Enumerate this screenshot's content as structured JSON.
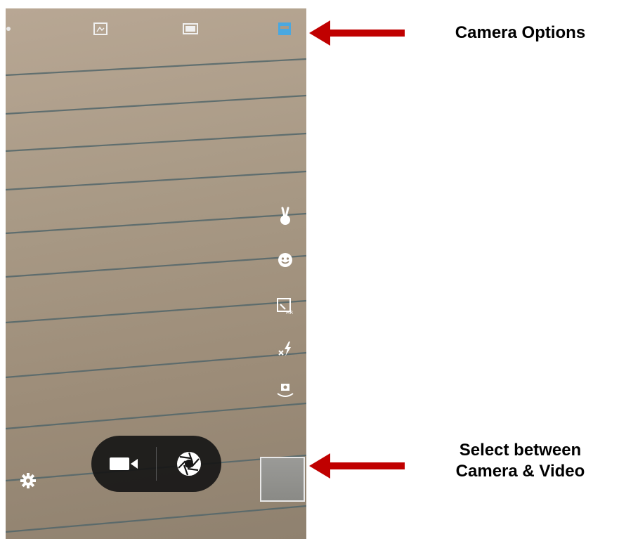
{
  "annotations": {
    "camera_options": "Camera Options",
    "select_line1": "Select between",
    "select_line2": "Camera & Video"
  },
  "colors": {
    "arrow": "#c00000",
    "active_mode": "#4aa8e0",
    "viewfinder": "#a99a86"
  },
  "top_icons": [
    "panorama-mode-icon",
    "scene-mode-icon",
    "camera-mode-icon"
  ],
  "side_icons": [
    "gesture-shot-icon",
    "face-beauty-icon",
    "hdr-icon",
    "flash-off-icon",
    "switch-camera-icon"
  ],
  "bottom_controls": {
    "video": "video-record-icon",
    "shutter": "shutter-icon",
    "settings": "settings-gear-icon"
  }
}
